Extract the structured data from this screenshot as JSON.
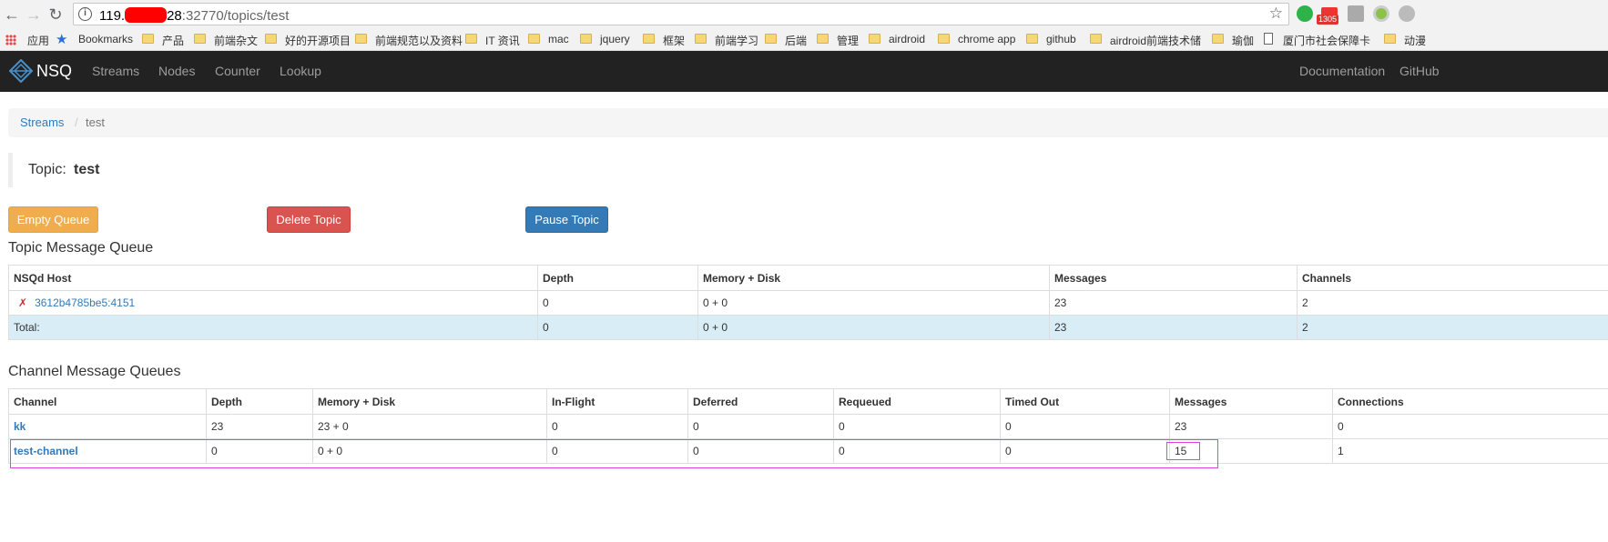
{
  "browser": {
    "url_prefix": "119.",
    "url_mid": "28",
    "url_suffix": ":32770/topics/test",
    "mail_badge": "1305",
    "bookmarks": [
      {
        "label": "应用",
        "icon": "apps-grid-icon"
      },
      {
        "label": "Bookmarks",
        "icon": "star-icon"
      },
      {
        "label": "产品",
        "icon": "folder-icon"
      },
      {
        "label": "前端杂文",
        "icon": "folder-icon"
      },
      {
        "label": "好的开源项目",
        "icon": "folder-icon"
      },
      {
        "label": "前端规范以及资料",
        "icon": "folder-icon"
      },
      {
        "label": "IT 资讯",
        "icon": "folder-icon"
      },
      {
        "label": "mac",
        "icon": "folder-icon"
      },
      {
        "label": "jquery",
        "icon": "folder-icon"
      },
      {
        "label": "框架",
        "icon": "folder-icon"
      },
      {
        "label": "前端学习",
        "icon": "folder-icon"
      },
      {
        "label": "后端",
        "icon": "folder-icon"
      },
      {
        "label": "管理",
        "icon": "folder-icon"
      },
      {
        "label": "airdroid",
        "icon": "folder-icon"
      },
      {
        "label": "chrome app",
        "icon": "folder-icon"
      },
      {
        "label": "github",
        "icon": "folder-icon"
      },
      {
        "label": "airdroid前端技术储",
        "icon": "folder-icon"
      },
      {
        "label": "瑜伽",
        "icon": "folder-icon"
      },
      {
        "label": "厦门市社会保障卡信",
        "icon": "doc-icon"
      },
      {
        "label": "动漫",
        "icon": "folder-icon"
      }
    ]
  },
  "navbar": {
    "brand": "NSQ",
    "links": [
      "Streams",
      "Nodes",
      "Counter",
      "Lookup"
    ],
    "right_links": [
      "Documentation",
      "GitHub"
    ]
  },
  "breadcrumb": {
    "parent": "Streams",
    "separator": "/",
    "current": "test"
  },
  "topic": {
    "prefix": "Topic:",
    "name": "test"
  },
  "actions": {
    "empty": "Empty Queue",
    "delete": "Delete Topic",
    "pause": "Pause Topic"
  },
  "topic_queue": {
    "heading": "Topic Message Queue",
    "columns": [
      "NSQd Host",
      "Depth",
      "Memory + Disk",
      "Messages",
      "Channels"
    ],
    "rows": [
      {
        "host": "3612b4785be5:4151",
        "depth": "0",
        "mem_disk": "0 + 0",
        "messages": "23",
        "channels": "2"
      }
    ],
    "total": {
      "label": "Total:",
      "depth": "0",
      "mem_disk": "0 + 0",
      "messages": "23",
      "channels": "2"
    }
  },
  "channel_queue": {
    "heading": "Channel Message Queues",
    "columns": [
      "Channel",
      "Depth",
      "Memory + Disk",
      "In-Flight",
      "Deferred",
      "Requeued",
      "Timed Out",
      "Messages",
      "Connections"
    ],
    "rows": [
      {
        "channel": "kk",
        "depth": "23",
        "mem_disk": "23 + 0",
        "in_flight": "0",
        "deferred": "0",
        "requeued": "0",
        "timed_out": "0",
        "messages": "23",
        "connections": "0"
      },
      {
        "channel": "test-channel",
        "depth": "0",
        "mem_disk": "0 + 0",
        "in_flight": "0",
        "deferred": "0",
        "requeued": "0",
        "timed_out": "0",
        "messages": "15",
        "connections": "1"
      }
    ]
  },
  "colors": {
    "navbar": "#222222",
    "link": "#337ab7",
    "warning": "#f0ad4e",
    "danger": "#d9534f",
    "primary": "#337ab7",
    "total_row": "#d9edf7",
    "highlight": "#e040e0"
  }
}
